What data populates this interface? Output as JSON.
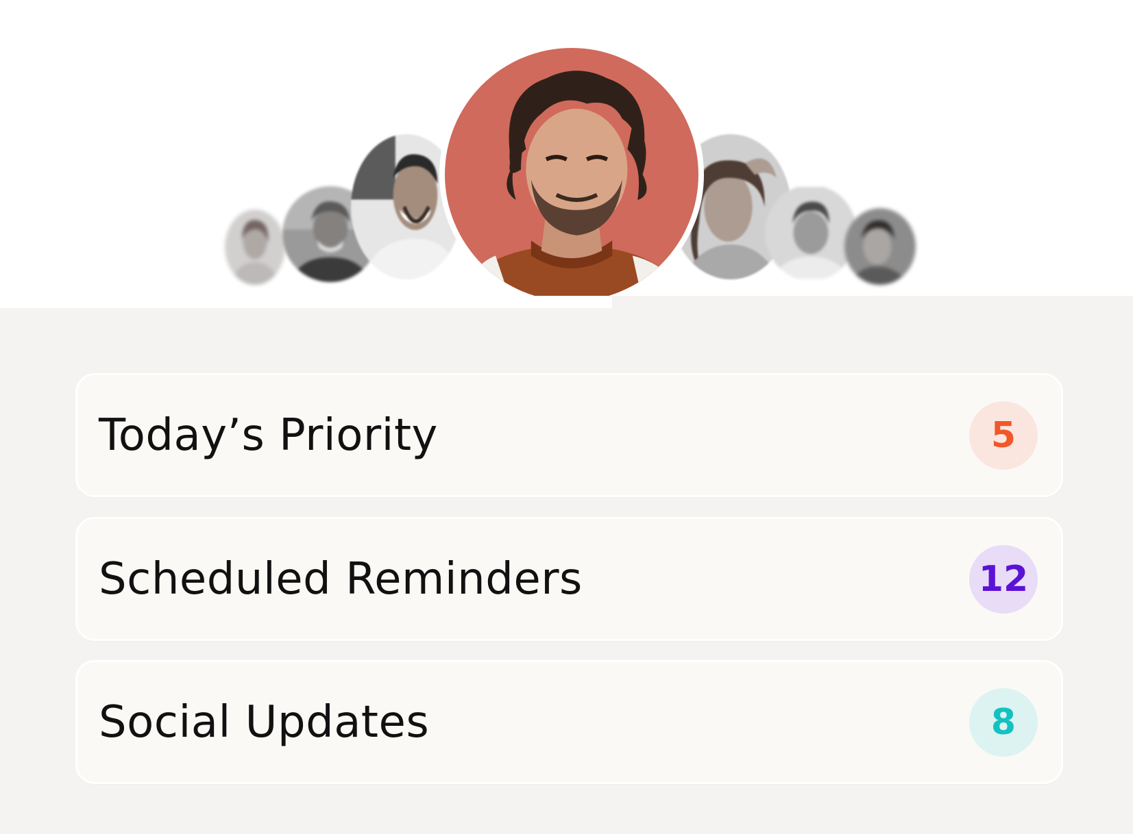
{
  "colors": {
    "top_background": "#ffffff",
    "panel_background": "#f4f3f1",
    "card_background": "#faf9f6"
  },
  "avatars": [
    {
      "name": "avatar-far-left",
      "icon": "person-photo"
    },
    {
      "name": "avatar-left-2",
      "icon": "person-photo"
    },
    {
      "name": "avatar-left-1",
      "icon": "person-photo"
    },
    {
      "name": "avatar-featured",
      "icon": "person-photo"
    },
    {
      "name": "avatar-right-1",
      "icon": "person-photo"
    },
    {
      "name": "avatar-right-2",
      "icon": "person-photo"
    },
    {
      "name": "avatar-far-right",
      "icon": "person-photo"
    }
  ],
  "categories": [
    {
      "label": "Today’s Priority",
      "count": "5",
      "badge_bg": "#fbe6df",
      "badge_fg": "#f0582b"
    },
    {
      "label": "Scheduled Reminders",
      "count": "12",
      "badge_bg": "#e8dcf7",
      "badge_fg": "#5b12d6"
    },
    {
      "label": "Social Updates",
      "count": "8",
      "badge_bg": "#dcf3f1",
      "badge_fg": "#13c1c1"
    }
  ]
}
